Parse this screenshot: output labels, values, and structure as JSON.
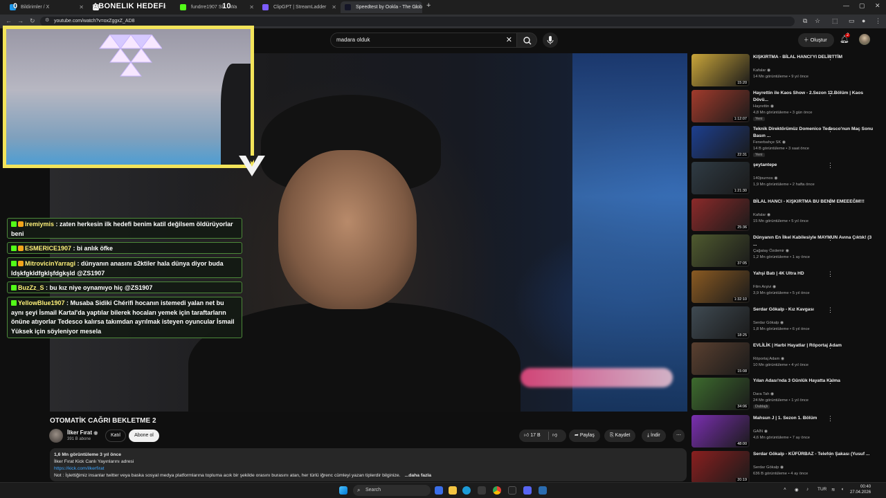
{
  "browser": {
    "tabs": [
      {
        "label": "Bildirimler / X",
        "color": "#1d9bf0"
      },
      {
        "label": "",
        "color": "#ffffff"
      },
      {
        "label": "fundrre1907 Str... Wa",
        "color": "#53fc18"
      },
      {
        "label": "ClipGPT | StreamLadder",
        "color": "#7c5cff"
      },
      {
        "label": "Speedtest by Ookla - The Glob",
        "color": "#141526"
      }
    ],
    "overlay_left": "0",
    "overlay_title": "ABONELIK HEDEFI",
    "overlay_count": "10",
    "url": "youtube.com/watch?v=oxZggxZ_AD8"
  },
  "youtube": {
    "search_query": "madara olduk",
    "create_label": "Oluştur",
    "notification_count": "2"
  },
  "video": {
    "title": "OTOMATİK CAĞRI BEKLETME 2",
    "channel": "İlker Fırat",
    "subscribers": "391 B abone",
    "join_label": "Katıl",
    "subscribe_label": "Abone ol",
    "likes": "17 B",
    "share_label": "Paylaş",
    "save_label": "Kaydet",
    "download_label": "İndir",
    "description": {
      "meta": "1,6 Mn görüntüleme  3 yıl önce",
      "line1": "İlker Fırat Kick Canlı Yayınlarını adresi",
      "link": "https://kick.com/ilkerfirat",
      "line3": "Not : İşlettiğimiz insanlar twitter veya baska sosyal medya platformlarına topluma acık bir şekilde orasını burasını atan, her türlü iğrenc cümleyi yazan tiplerdir bilginize.",
      "more": "...daha fazla"
    }
  },
  "chat": [
    {
      "user": "iremiymis",
      "text": " : zaten herkesin ilk hedefi benim katil değilsem öldürüyorlar beni"
    },
    {
      "user": "ESMERICE1907",
      "text": " : bi anlık öfke"
    },
    {
      "user": "MitrovicinYarragi",
      "text": " : dünyanın anasını s2ktiler hala dünya diyor buda ldşkfgkldfgklşfdgkşld @ZS1907"
    },
    {
      "user": "BuzZz_S",
      "text": " : bu kız niye oynamıyo hiç @ZS1907"
    },
    {
      "user": "YellowBlue1907",
      "text": " : Musaba Sidiki Chérifi hocanın istemedi yalan net bu aynı şeyi İsmail Kartal'da yaptılar bilerek hocaları yemek için taraftarların önüne atıyorlar Tedesco kalırsa takımdan ayrılmak isteyen oyuncular İsmail Yüksek için söyleniyor mesela"
    }
  ],
  "recommendations": [
    {
      "title": "KIŞKIRTMA - BİLAL HANCI'YI DELİRTTİM",
      "channel": "Kafalar",
      "meta": "14 Mn görüntüleme • 9 yıl önce",
      "duration": "15:20",
      "badge": "",
      "color": "#c9a53a"
    },
    {
      "title": "Hayrettin ile Kaos Show - 2.Sezon 12.Bölüm | Kaos Dövü...",
      "channel": "Hayrettin",
      "meta": "4,8 Mn görüntüleme • 3 gün önce",
      "duration": "1:12:07",
      "badge": "Yeni",
      "color": "#a23b2c"
    },
    {
      "title": "Teknik Direktörümüz Domenico Tedesco'nun Maç Sonu Basın ...",
      "channel": "Fenerbahçe SK",
      "meta": "14 B görüntüleme • 3 saat önce",
      "duration": "22:31",
      "badge": "Yeni",
      "color": "#1d3f8f"
    },
    {
      "title": "şeytantepe",
      "channel": "140journos",
      "meta": "1,9 Mn görüntüleme • 2 hafta önce",
      "duration": "1:21:30",
      "badge": "",
      "color": "#2f3b44"
    },
    {
      "title": "BİLAL HANCI - KIŞKIRTMA BU BENİM EMEEEĞM!!!",
      "channel": "Kafalar",
      "meta": "15 Mn görüntüleme • 5 yıl önce",
      "duration": "25:36",
      "badge": "",
      "color": "#8c2a2a"
    },
    {
      "title": "Dünyanın En İlkel Kabilesiyle MAYMUN Avına Çıktık! (3 ...",
      "channel": "Çağatay Özdemir",
      "meta": "1,2 Mn görüntüleme • 1 ay önce",
      "duration": "37:05",
      "badge": "",
      "color": "#4f5a2f"
    },
    {
      "title": "Yahşi Batı | 4K Ultra HD",
      "channel": "Film Arşivi",
      "meta": "3,9 Mn görüntüleme • 5 yıl önce",
      "duration": "1:32:10",
      "badge": "",
      "color": "#8a5a22"
    },
    {
      "title": "Serdar Gökalp - Kız Kavgası",
      "channel": "Serdar Gökalp",
      "meta": "1,8 Mn görüntüleme • 6 yıl önce",
      "duration": "18:25",
      "badge": "",
      "color": "#3f4a52"
    },
    {
      "title": "EVLİLİK | Harbi Hayatlar | Röportaj Adam",
      "channel": "Röportaj Adam",
      "meta": "10 Mn görüntüleme • 4 yıl önce",
      "duration": "15:08",
      "badge": "",
      "color": "#5a4030"
    },
    {
      "title": "Yılan Adası'nda 3 Günlük Hayatta Kalma",
      "channel": "Dara Tah",
      "meta": "24 Mn görüntüleme • 1 yıl önce",
      "duration": "34:06",
      "badge": "Dublajlı",
      "color": "#3d6b2e"
    },
    {
      "title": "Mahsun J | 1. Sezon 1. Bölüm",
      "channel": "GAİN",
      "meta": "4,6 Mn görüntüleme • 7 ay önce",
      "duration": "48:00",
      "badge": "",
      "color": "#7a2fb0"
    },
    {
      "title": "Serdar Gökalp - KÜFÜRBAZ - Telefon Şakası (Yusuf ...",
      "channel": "Serdar Gökalp",
      "meta": "636 B görüntüleme • 4 ay önce",
      "duration": "20:19",
      "badge": "",
      "color": "#8a1f1f"
    }
  ],
  "taskbar": {
    "search_placeholder": "Search",
    "language": "TUR",
    "time": "00:40",
    "date": "27.04.2026"
  }
}
